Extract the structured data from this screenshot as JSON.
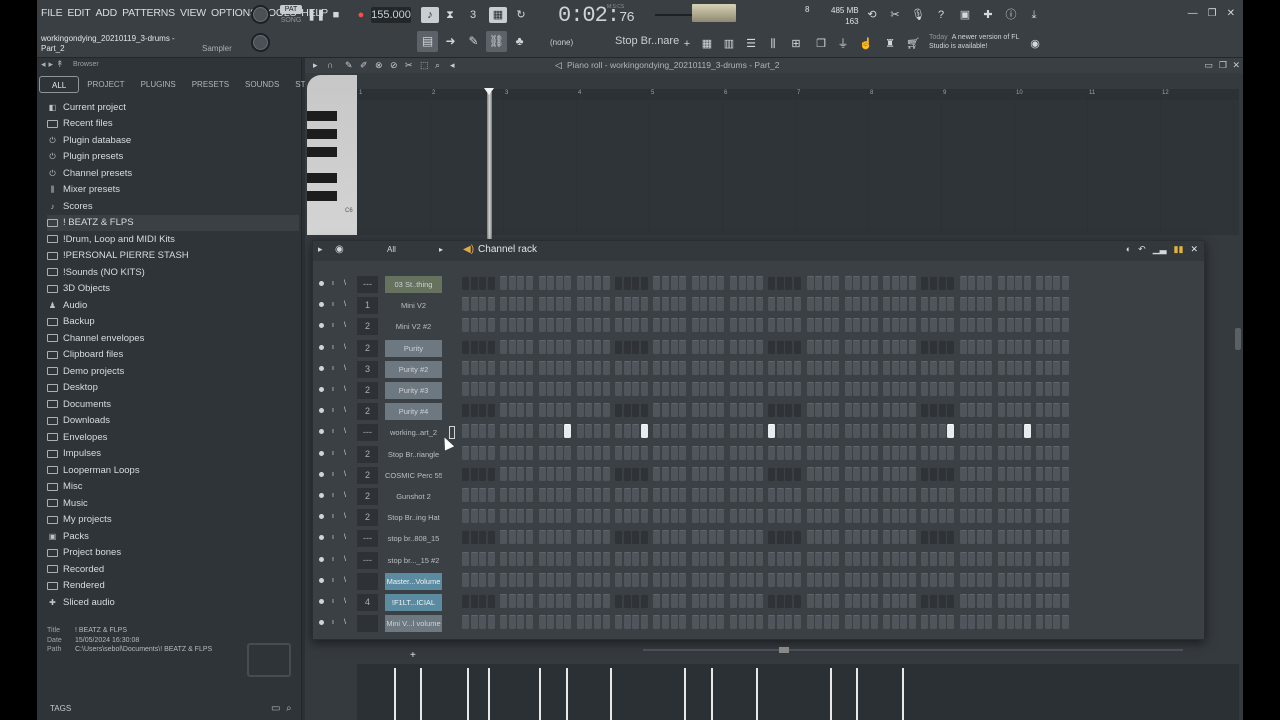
{
  "menu": [
    "FILE",
    "EDIT",
    "ADD",
    "PATTERNS",
    "VIEW",
    "OPTIONS",
    "TOOLS",
    "HELP"
  ],
  "project": {
    "name": "workingondying_20210119_3-drums - Part_2",
    "instrument_label": "Sampler"
  },
  "transport": {
    "pat_label": "PAT",
    "song_label": "SONG",
    "tempo": "155.000",
    "time": "0:02",
    "time_sub": "76",
    "time_units": "M:S:CS"
  },
  "monitor": {
    "memory": "485 MB",
    "cpu": "163",
    "polyphony": "8"
  },
  "toolbar": {
    "snap_label": "(none)",
    "pattern_name": "Stop Br..nare",
    "hint_today": "Today",
    "hint_text": "A newer version of FL Studio is available!"
  },
  "browser": {
    "title": "Browser",
    "tabs": [
      "ALL",
      "PROJECT",
      "PLUGINS",
      "PRESETS",
      "SOUNDS",
      "STARRED"
    ],
    "items": [
      {
        "label": "Current project",
        "icon": "project-icon"
      },
      {
        "label": "Recent files",
        "icon": "folder-icon"
      },
      {
        "label": "Plugin database",
        "icon": "plugin-icon"
      },
      {
        "label": "Plugin presets",
        "icon": "plugin-icon"
      },
      {
        "label": "Channel presets",
        "icon": "plugin-icon"
      },
      {
        "label": "Mixer presets",
        "icon": "mixer-icon"
      },
      {
        "label": "Scores",
        "icon": "note-icon"
      },
      {
        "label": "! BEATZ & FLPS",
        "icon": "folder-icon"
      },
      {
        "label": "!Drum, Loop and MIDI Kits",
        "icon": "folder-icon"
      },
      {
        "label": "!PERSONAL PIERRE STASH",
        "icon": "folder-icon"
      },
      {
        "label": "!Sounds (NO KITS)",
        "icon": "folder-icon"
      },
      {
        "label": "3D Objects",
        "icon": "folder-icon"
      },
      {
        "label": "Audio",
        "icon": "user-icon"
      },
      {
        "label": "Backup",
        "icon": "folder-icon"
      },
      {
        "label": "Channel envelopes",
        "icon": "folder-icon"
      },
      {
        "label": "Clipboard files",
        "icon": "folder-icon"
      },
      {
        "label": "Demo projects",
        "icon": "folder-icon"
      },
      {
        "label": "Desktop",
        "icon": "folder-icon"
      },
      {
        "label": "Documents",
        "icon": "folder-icon"
      },
      {
        "label": "Downloads",
        "icon": "folder-icon"
      },
      {
        "label": "Envelopes",
        "icon": "folder-icon"
      },
      {
        "label": "Impulses",
        "icon": "folder-icon"
      },
      {
        "label": "Looperman Loops",
        "icon": "folder-icon"
      },
      {
        "label": "Misc",
        "icon": "folder-icon"
      },
      {
        "label": "Music",
        "icon": "folder-icon"
      },
      {
        "label": "My projects",
        "icon": "folder-icon"
      },
      {
        "label": "Packs",
        "icon": "packs-icon"
      },
      {
        "label": "Project bones",
        "icon": "folder-icon"
      },
      {
        "label": "Recorded",
        "icon": "folder-icon"
      },
      {
        "label": "Rendered",
        "icon": "folder-icon"
      },
      {
        "label": "Sliced audio",
        "icon": "slice-icon"
      }
    ],
    "info": {
      "title_key": "Title",
      "title_val": "! BEATZ & FLPS",
      "date_key": "Date",
      "date_val": "15/05/2024 16:30:08",
      "path_key": "Path",
      "path_val": "C:\\Users\\sebol\\Documents\\! BEATZ & FLPS"
    },
    "tags_label": "TAGS"
  },
  "piano_roll": {
    "title": "Piano roll - workingondying_20210119_3-drums - Part_2",
    "bars": [
      "1",
      "2",
      "3",
      "4",
      "5",
      "6",
      "7",
      "8",
      "9",
      "10",
      "11",
      "12"
    ],
    "key_label": "C6"
  },
  "channel_rack": {
    "title": "Channel rack",
    "filter": "All",
    "channels": [
      {
        "name": "03 St..thing",
        "route": "---",
        "style": "hl"
      },
      {
        "name": "Mini V2",
        "route": "1",
        "style": "plain"
      },
      {
        "name": "Mini V2 #2",
        "route": "2",
        "style": "plain"
      },
      {
        "name": "Purity",
        "route": "2",
        "style": "mid"
      },
      {
        "name": "Purity #2",
        "route": "3",
        "style": "mid"
      },
      {
        "name": "Purity #3",
        "route": "2",
        "style": "mid"
      },
      {
        "name": "Purity #4",
        "route": "2",
        "style": "mid"
      },
      {
        "name": "working..art_2",
        "route": "---",
        "style": "plain"
      },
      {
        "name": "Stop Br..riangle",
        "route": "2",
        "style": "plain"
      },
      {
        "name": "COSMIC Perc 55",
        "route": "2",
        "style": "plain"
      },
      {
        "name": "Gunshot 2",
        "route": "2",
        "style": "plain"
      },
      {
        "name": "Stop Br..ing Hat",
        "route": "2",
        "style": "plain"
      },
      {
        "name": "stop br..808_15",
        "route": "---",
        "style": "plain"
      },
      {
        "name": "stop br..._15 #2",
        "route": "---",
        "style": "plain"
      },
      {
        "name": "Master...Volume",
        "route": "",
        "style": "sel"
      },
      {
        "name": "!F1LT...ICIAL",
        "route": "4",
        "style": "sel"
      },
      {
        "name": "Mini V...l volume",
        "route": "",
        "style": "mid"
      }
    ],
    "active_steps_row": 7,
    "active_steps": [
      11,
      19,
      32,
      51,
      59
    ]
  },
  "colors": {
    "accent_selected": "#5a8ba0",
    "record": "#ff4b4b",
    "speaker": "#e0a94a"
  }
}
